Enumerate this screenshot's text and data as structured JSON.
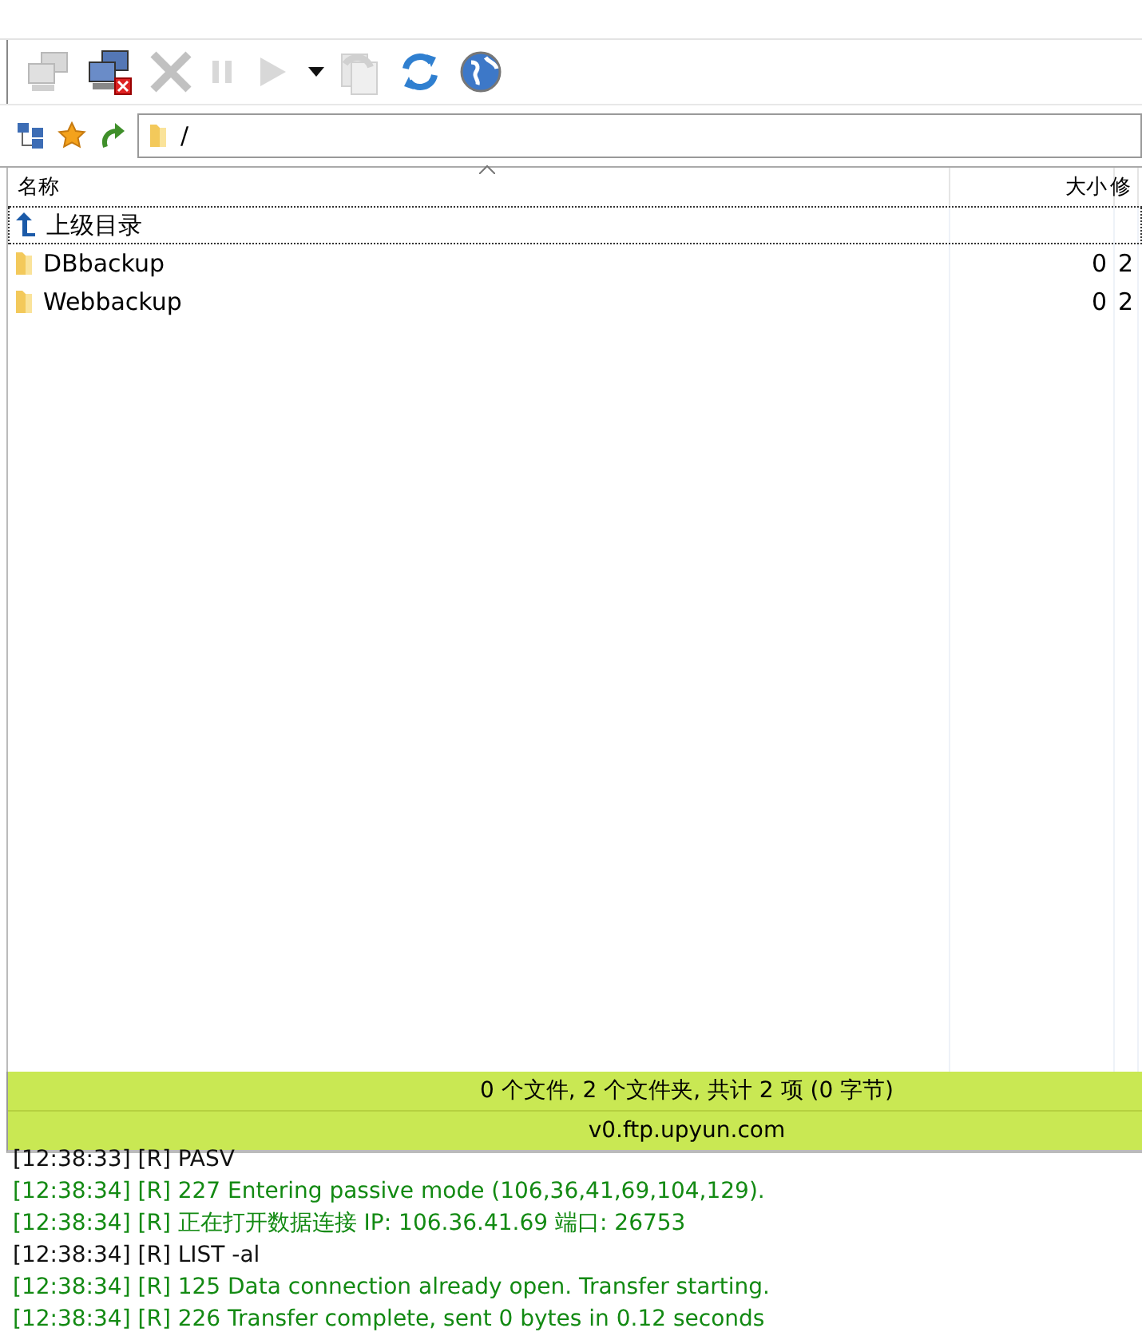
{
  "toolbar": {
    "buttons": [
      {
        "kind": "connect",
        "disabled": true
      },
      {
        "kind": "disconnect",
        "disabled": false
      },
      {
        "kind": "cancel",
        "disabled": true
      },
      {
        "kind": "pause",
        "disabled": true
      },
      {
        "kind": "play",
        "disabled": true
      },
      {
        "kind": "dropdown",
        "disabled": false
      },
      {
        "kind": "transfer",
        "disabled": true
      },
      {
        "kind": "refresh",
        "disabled": false
      },
      {
        "kind": "globe",
        "disabled": false
      }
    ]
  },
  "address_bar": {
    "value": "/"
  },
  "file_list": {
    "columns": [
      {
        "label": "名称",
        "sorted": true
      },
      {
        "label": "大小",
        "sorted": false
      },
      {
        "label": "修",
        "sorted": false
      }
    ],
    "rows": [
      {
        "kind": "parent",
        "name": "上级目录",
        "size": "",
        "column_3": "",
        "selected": true
      },
      {
        "kind": "folder",
        "name": "DBbackup",
        "size": "0",
        "column_3": "2",
        "selected": false
      },
      {
        "kind": "folder",
        "name": "Webbackup",
        "size": "0",
        "column_3": "2",
        "selected": false
      }
    ]
  },
  "status_bar": {
    "summary": "0 个文件, 2 个文件夹, 共计 2 项 (0 字节)",
    "host": "v0.ftp.upyun.com"
  },
  "log": [
    {
      "kind": "command",
      "text": "[12:38:33] [R] PASV"
    },
    {
      "kind": "reply",
      "text": "[12:38:34] [R] 227 Entering passive mode (106,36,41,69,104,129)."
    },
    {
      "kind": "reply",
      "text": "[12:38:34] [R] 正在打开数据连接 IP: 106.36.41.69 端口: 26753"
    },
    {
      "kind": "command",
      "text": "[12:38:34] [R] LIST -al"
    },
    {
      "kind": "reply",
      "text": "[12:38:34] [R] 125 Data connection already open. Transfer starting."
    },
    {
      "kind": "reply",
      "text": "[12:38:34] [R] 226 Transfer complete, sent 0 bytes in 0.12 seconds"
    }
  ]
}
